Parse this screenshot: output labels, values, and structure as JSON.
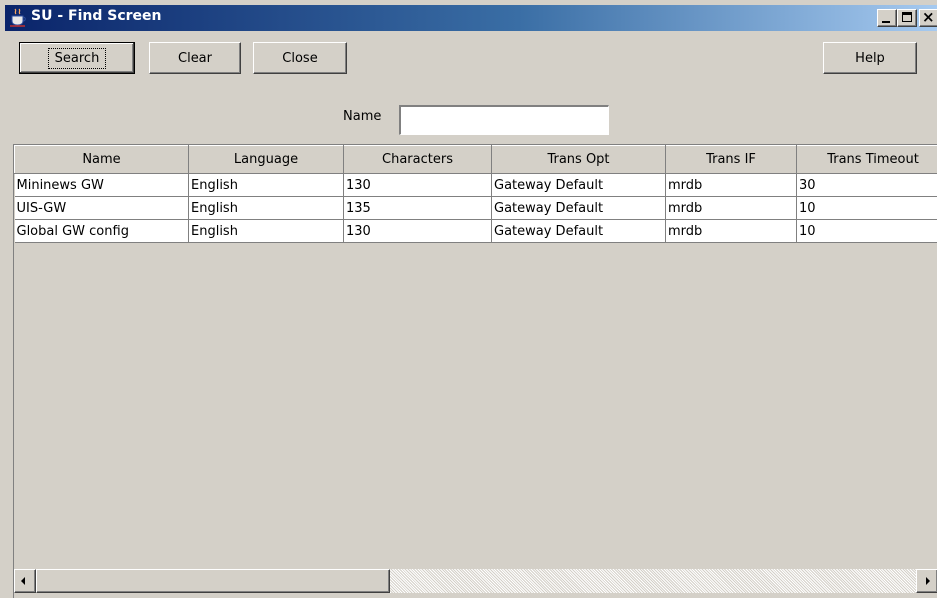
{
  "window": {
    "title": "SU - Find Screen",
    "icon": "java-coffee-cup-icon",
    "controls": {
      "minimize": "minimize-icon",
      "maximize": "maximize-icon",
      "close_glyph": "×"
    },
    "colors": {
      "titlebar_start": "#0a246a",
      "titlebar_end": "#a6caf0",
      "face": "#d4d0c8"
    }
  },
  "toolbar": {
    "search_label": "Search",
    "clear_label": "Clear",
    "close_label": "Close",
    "help_label": "Help"
  },
  "filter": {
    "name_label": "Name",
    "name_value": ""
  },
  "table": {
    "columns": [
      "Name",
      "Language",
      "Characters",
      "Trans Opt",
      "Trans IF",
      "Trans Timeout"
    ],
    "rows": [
      [
        "Mininews GW",
        "English",
        "130",
        "Gateway Default",
        "mrdb",
        "30"
      ],
      [
        "UIS-GW",
        "English",
        "135",
        "Gateway Default",
        "mrdb",
        "10"
      ],
      [
        "Global GW config",
        "English",
        "130",
        "Gateway Default",
        "mrdb",
        "10"
      ]
    ]
  },
  "scrollbar": {
    "left_icon": "scroll-left-arrow-icon",
    "right_icon": "scroll-right-arrow-icon"
  }
}
